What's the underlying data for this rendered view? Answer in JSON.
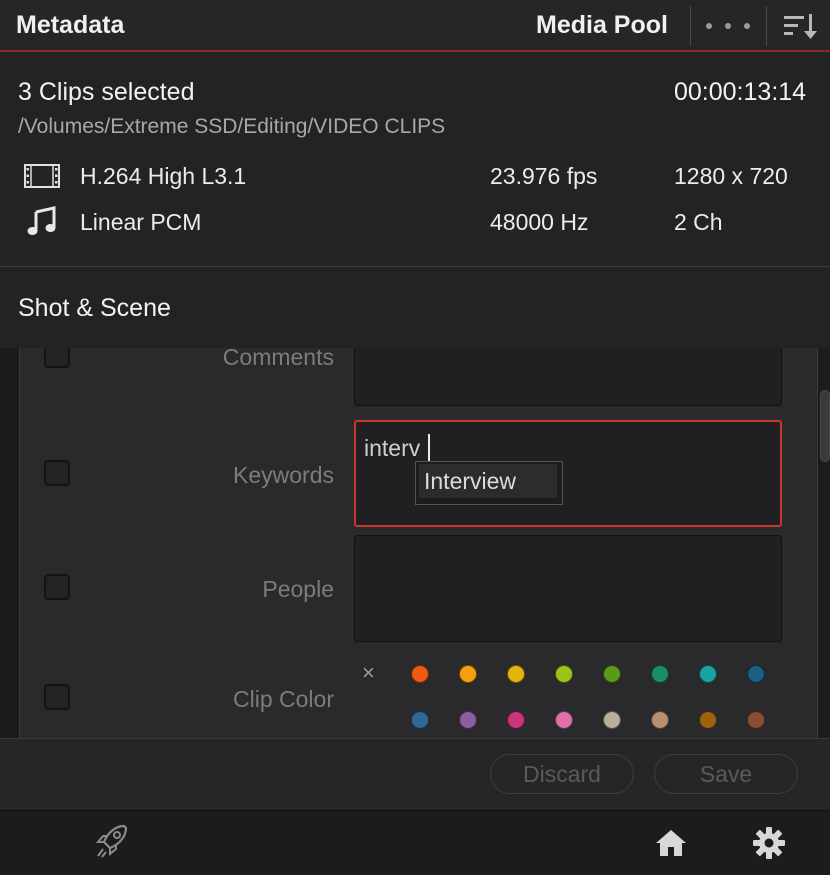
{
  "header": {
    "title": "Metadata",
    "media_pool_label": "Media Pool",
    "more_icon": "more-dots-icon",
    "sort_icon": "sort-icon"
  },
  "clip_info": {
    "selection": "3 Clips selected",
    "timecode": "00:00:13:14",
    "path": "/Volumes/Extreme SSD/Editing/VIDEO CLIPS",
    "video": {
      "icon": "film-icon",
      "codec": "H.264 High L3.1",
      "fps": "23.976 fps",
      "resolution": "1280 x 720"
    },
    "audio": {
      "icon": "music-note-icon",
      "codec": "Linear PCM",
      "rate": "48000 Hz",
      "channels": "2 Ch"
    }
  },
  "section": {
    "title": "Shot & Scene"
  },
  "fields": {
    "comments": {
      "label": "Comments",
      "value": ""
    },
    "keywords": {
      "label": "Keywords",
      "value": "interv",
      "suggestion": "Interview"
    },
    "people": {
      "label": "People",
      "value": ""
    },
    "clip_color": {
      "label": "Clip Color",
      "clear_symbol": "×",
      "colors": [
        "#ec5a14",
        "#f5a00f",
        "#e3b50e",
        "#9bc41c",
        "#5a9a1a",
        "#1e8f64",
        "#1ba3a3",
        "#1c5f82",
        "#2d6a9a",
        "#8e5fa0",
        "#c8367a",
        "#e070a8",
        "#b8ae9a",
        "#b88f72",
        "#9c6410",
        "#8a4e34"
      ]
    }
  },
  "actions": {
    "discard_label": "Discard",
    "save_label": "Save"
  },
  "bottom_nav": {
    "left_icon": "rocket-icon",
    "home_icon": "home-icon",
    "settings_icon": "gear-icon"
  },
  "colors": {
    "accent": "#c9372c",
    "header_underline": "#8b2a22"
  }
}
